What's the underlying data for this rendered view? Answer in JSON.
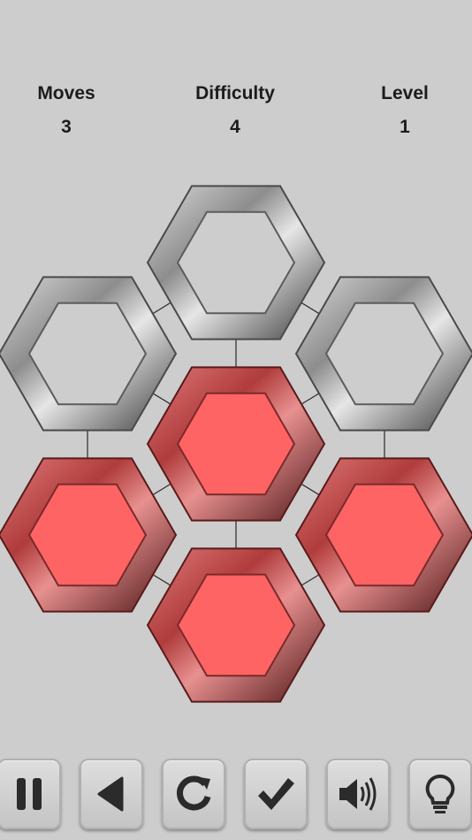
{
  "header": {
    "moves_label": "Moves",
    "moves_value": "3",
    "difficulty_label": "Difficulty",
    "difficulty_value": "4",
    "level_label": "Level",
    "level_value": "1"
  },
  "colors": {
    "background": "#cdcdcd",
    "active_fill": "#ff6464",
    "active_frame": "#c23a3a",
    "inactive_frame": "#8a8a8a",
    "text": "#1c1c1c"
  },
  "board": {
    "tiles": [
      {
        "name": "tile-top",
        "state": "off"
      },
      {
        "name": "tile-upper-left",
        "state": "off"
      },
      {
        "name": "tile-upper-right",
        "state": "off"
      },
      {
        "name": "tile-center",
        "state": "on"
      },
      {
        "name": "tile-lower-left",
        "state": "on"
      },
      {
        "name": "tile-lower-right",
        "state": "on"
      },
      {
        "name": "tile-bottom",
        "state": "on"
      }
    ]
  },
  "toolbar": {
    "buttons": [
      {
        "name": "pause-button",
        "icon": "pause-icon"
      },
      {
        "name": "back-button",
        "icon": "back-triangle-icon"
      },
      {
        "name": "restart-button",
        "icon": "restart-icon"
      },
      {
        "name": "check-button",
        "icon": "checkmark-icon"
      },
      {
        "name": "sound-button",
        "icon": "speaker-icon"
      },
      {
        "name": "hint-button",
        "icon": "lightbulb-icon"
      }
    ]
  }
}
